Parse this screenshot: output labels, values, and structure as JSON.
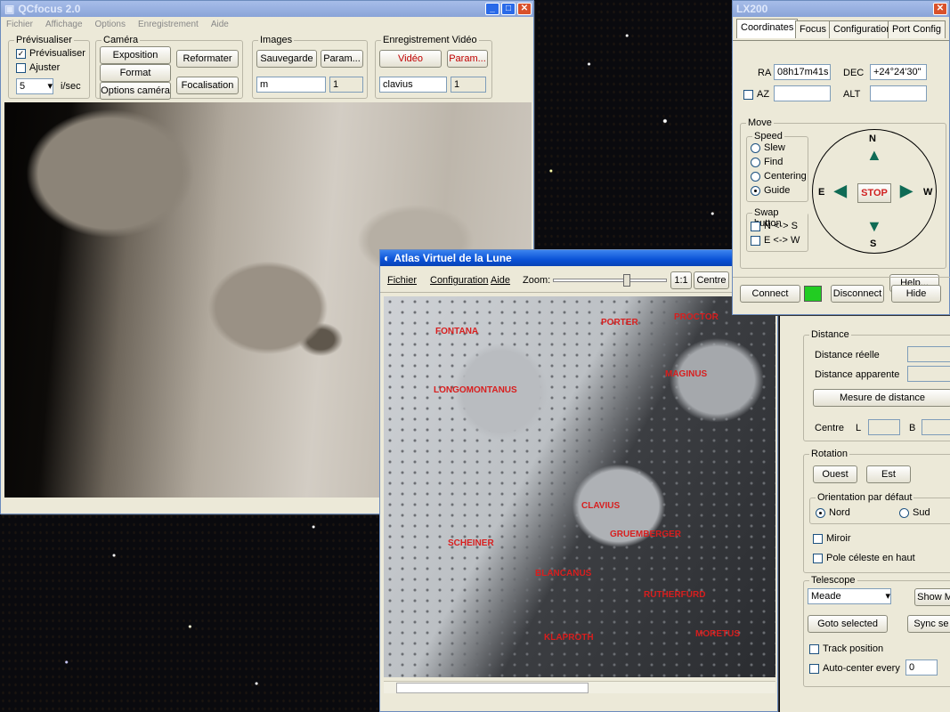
{
  "qcfocus": {
    "title": "QCfocus 2.0",
    "menu": [
      "Fichier",
      "Affichage",
      "Options",
      "Enregistrement",
      "Aide"
    ],
    "preview": {
      "group_label": "Prévisualiser",
      "check_preview": "Prévisualiser",
      "check_adjust": "Ajuster",
      "rate_value": "5",
      "rate_unit": "i/sec"
    },
    "camera": {
      "group_label": "Caméra",
      "exposition": "Exposition",
      "format": "Format",
      "options": "Options caméra",
      "reformater": "Reformater",
      "focalisation": "Focalisation"
    },
    "images": {
      "group_label": "Images",
      "save": "Sauvegarde",
      "param": "Param...",
      "name_value": "m",
      "index_value": "1"
    },
    "video": {
      "group_label": "Enregistrement Vidéo",
      "video": "Vidéo",
      "param": "Param...",
      "name_value": "clavius",
      "index_value": "1"
    }
  },
  "scope": {
    "title": "LX200",
    "tabs": [
      "Coordinates",
      "Focus",
      "Configuration",
      "Port Config"
    ],
    "ra_label": "RA",
    "ra_value": "08h17m41s",
    "dec_label": "DEC",
    "dec_value": "+24°24'30\"",
    "az_label": "AZ",
    "alt_label": "ALT",
    "move_label": "Move",
    "speed_label": "Speed",
    "speeds": [
      "Slew",
      "Find",
      "Centering",
      "Guide"
    ],
    "swap_label": "Swap button",
    "swap_ns": "N <-> S",
    "swap_ew": "E <-> W",
    "dir_n": "N",
    "dir_s": "S",
    "dir_e": "E",
    "dir_w": "W",
    "stop": "STOP",
    "help": "Help...",
    "connect": "Connect",
    "disconnect": "Disconnect",
    "hide": "Hide",
    "status_color": "#22cc22"
  },
  "atlas": {
    "title": "Atlas Virtuel de la Lune",
    "menu": [
      "Fichier",
      "Configuration",
      "Aide"
    ],
    "zoom_label": "Zoom:",
    "zoom_ratio": "1:1",
    "centre": "Centre",
    "crater_labels": [
      "FONTANA",
      "LONGOMONTANUS",
      "CLAVIUS",
      "BLANCANUS",
      "KLAPROTH",
      "MORETUS",
      "PROCTOR",
      "SCHEINER",
      "RUTHERFURD",
      "PORTER",
      "MAGINUS",
      "GRUEMBERGER"
    ]
  },
  "side": {
    "distance_label": "Distance",
    "real_distance": "Distance réelle",
    "apparent_distance": "Distance apparente",
    "measure": "Mesure de distance",
    "centre": "Centre",
    "l_label": "L",
    "b_label": "B",
    "rotation_label": "Rotation",
    "west": "Ouest",
    "east": "Est",
    "default_orientation": "Orientation par défaut",
    "north": "Nord",
    "south": "Sud",
    "mirror": "Miroir",
    "celestial_pole": "Pole céleste en haut",
    "telescope_label": "Telescope",
    "telescope_value": "Meade",
    "show": "Show M",
    "goto": "Goto selected",
    "sync": "Sync se",
    "track": "Track position",
    "autocenter": "Auto-center every",
    "autocenter_value": "0"
  }
}
